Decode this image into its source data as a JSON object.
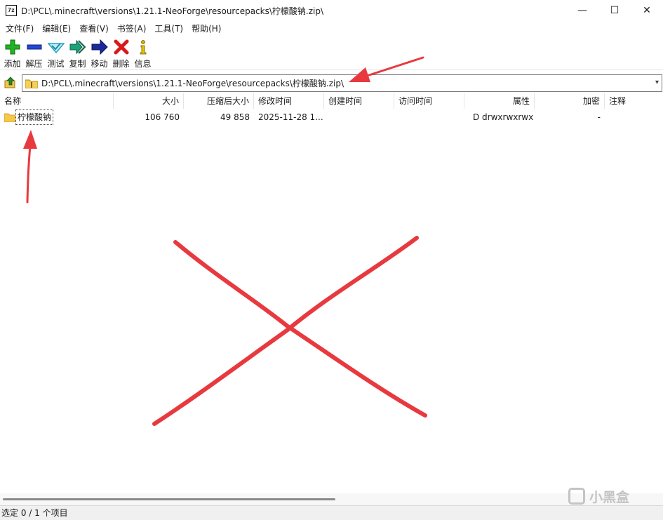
{
  "window": {
    "title": "D:\\PCL\\.minecraft\\versions\\1.21.1-NeoForge\\resourcepacks\\柠檬酸钠.zip\\",
    "app_icon": "7z",
    "minimize": "—",
    "maximize": "☐",
    "close": "✕"
  },
  "menu": [
    "文件(F)",
    "编辑(E)",
    "查看(V)",
    "书签(A)",
    "工具(T)",
    "帮助(H)"
  ],
  "toolbar": [
    {
      "label": "添加",
      "icon": "plus-icon",
      "color": "#19a319"
    },
    {
      "label": "解压",
      "icon": "minus-icon",
      "color": "#1f3fbf"
    },
    {
      "label": "测试",
      "icon": "check-icon",
      "color": "#2aa6c0"
    },
    {
      "label": "复制",
      "icon": "double-arrow-icon",
      "color": "#1a9a6c"
    },
    {
      "label": "移动",
      "icon": "arrow-right-icon",
      "color": "#1a2a9a"
    },
    {
      "label": "删除",
      "icon": "delete-x-icon",
      "color": "#d81a1a"
    },
    {
      "label": "信息",
      "icon": "info-icon",
      "color": "#c9a800"
    }
  ],
  "address": {
    "path": "D:\\PCL\\.minecraft\\versions\\1.21.1-NeoForge\\resourcepacks\\柠檬酸钠.zip\\"
  },
  "columns": [
    "名称",
    "大小",
    "压缩后大小",
    "修改时间",
    "创建时间",
    "访问时间",
    "属性",
    "加密",
    "注释"
  ],
  "rows": [
    {
      "name": "柠檬酸钠",
      "size": "106 760",
      "packed": "49 858",
      "modified": "2025-11-28 1...",
      "created": "",
      "accessed": "",
      "attributes": "D drwxrwxrwx",
      "encrypted": "-",
      "comment": ""
    }
  ],
  "status": "选定 0 / 1 个项目",
  "watermark": "小黑盒",
  "annotation_color": "#e8393f"
}
